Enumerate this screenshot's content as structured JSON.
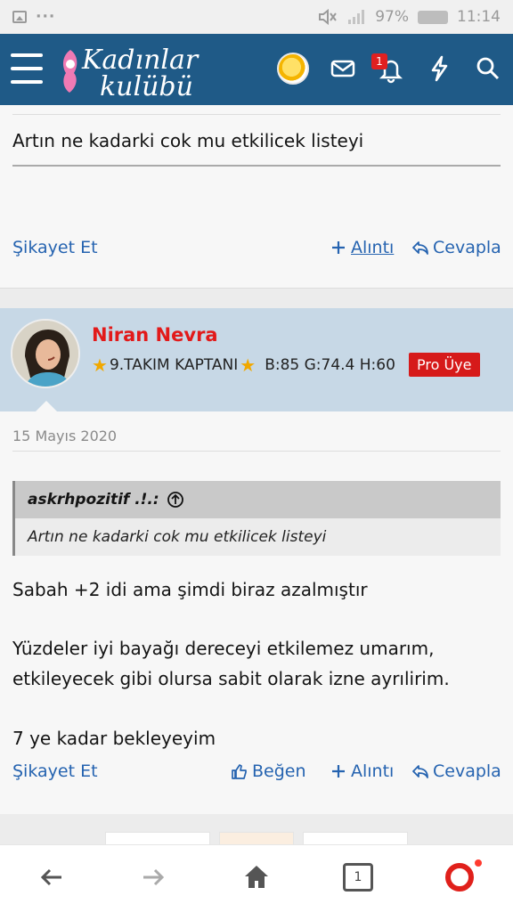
{
  "status_bar": {
    "battery": "97%",
    "time": "11:14"
  },
  "header": {
    "logo_line1": "Kadınlar",
    "logo_line2": "kulübü",
    "notification_count": "1"
  },
  "post1": {
    "text": "Artın ne kadarki cok mu etkilicek listeyi",
    "report": "Şikayet Et",
    "quote_action": "Alıntı",
    "reply_action": "Cevapla"
  },
  "post2": {
    "username": "Niran Nevra",
    "user_title": "9.TAKIM KAPTANI",
    "user_stats": "B:85 G:74.4 H:60",
    "pro_badge": "Pro Üye",
    "date": "15 Mayıs 2020",
    "quote_author": "askrhpozitif .!.:",
    "quote_text": "Artın ne kadarki cok mu etkilicek listeyi",
    "body": [
      "Sabah +2 idi ama şimdi biraz azalmıştır",
      "Yüzdeler iyi bayağı dereceyi etkilemez umarım,",
      "etkileyecek gibi olursa sabit olarak izne ayrılirim.",
      "7 ye kadar bekleyeyim"
    ],
    "report": "Şikayet Et",
    "like_action": "Beğen",
    "quote_action": "Alıntı",
    "reply_action": "Cevapla"
  },
  "bottom_bar": {
    "tab_count": "1"
  },
  "colors": {
    "header": "#1f5a87",
    "link": "#2563b0",
    "username": "#e21a1a",
    "pro_badge": "#d61a1a"
  }
}
